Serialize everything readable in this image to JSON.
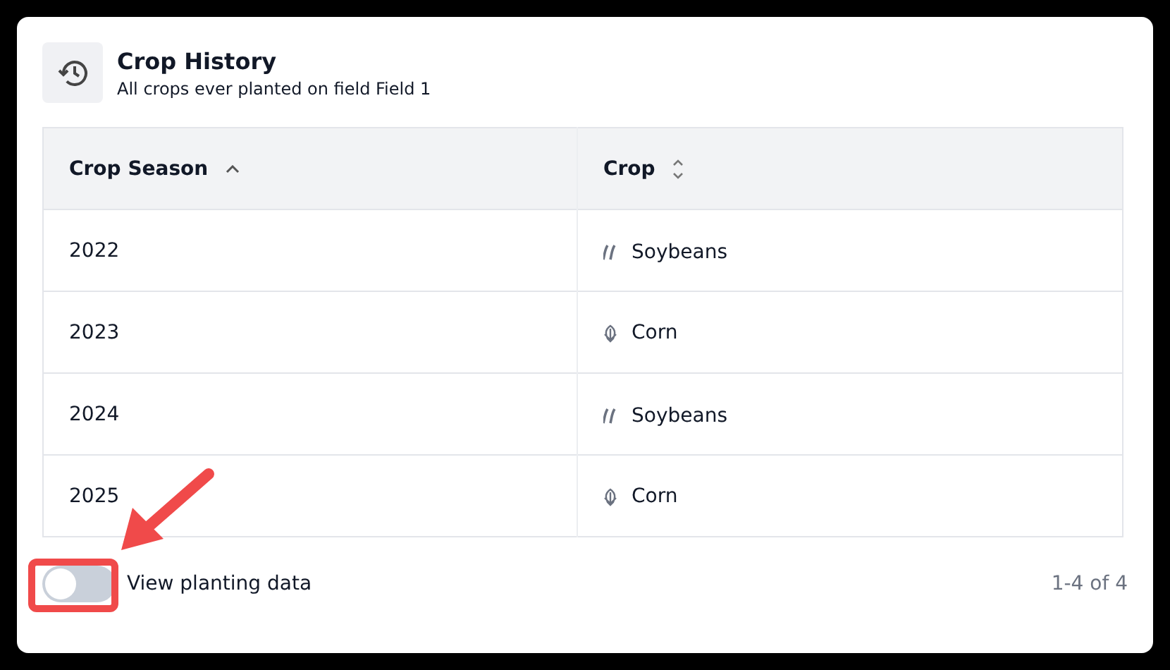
{
  "header": {
    "title": "Crop History",
    "subtitle": "All crops ever planted on field Field 1"
  },
  "table": {
    "columns": [
      {
        "label": "Crop Season",
        "kind": "ascending"
      },
      {
        "label": "Crop",
        "kind": "sortable"
      }
    ],
    "rows": [
      {
        "season": "2022",
        "crop": "Soybeans",
        "kind": "soybean"
      },
      {
        "season": "2023",
        "crop": "Corn",
        "kind": "corn"
      },
      {
        "season": "2024",
        "crop": "Soybeans",
        "kind": "soybean"
      },
      {
        "season": "2025",
        "crop": "Corn",
        "kind": "corn"
      }
    ]
  },
  "footer": {
    "toggle": {
      "label": "View planting data",
      "on": false
    },
    "pagination": "1-4 of 4"
  }
}
